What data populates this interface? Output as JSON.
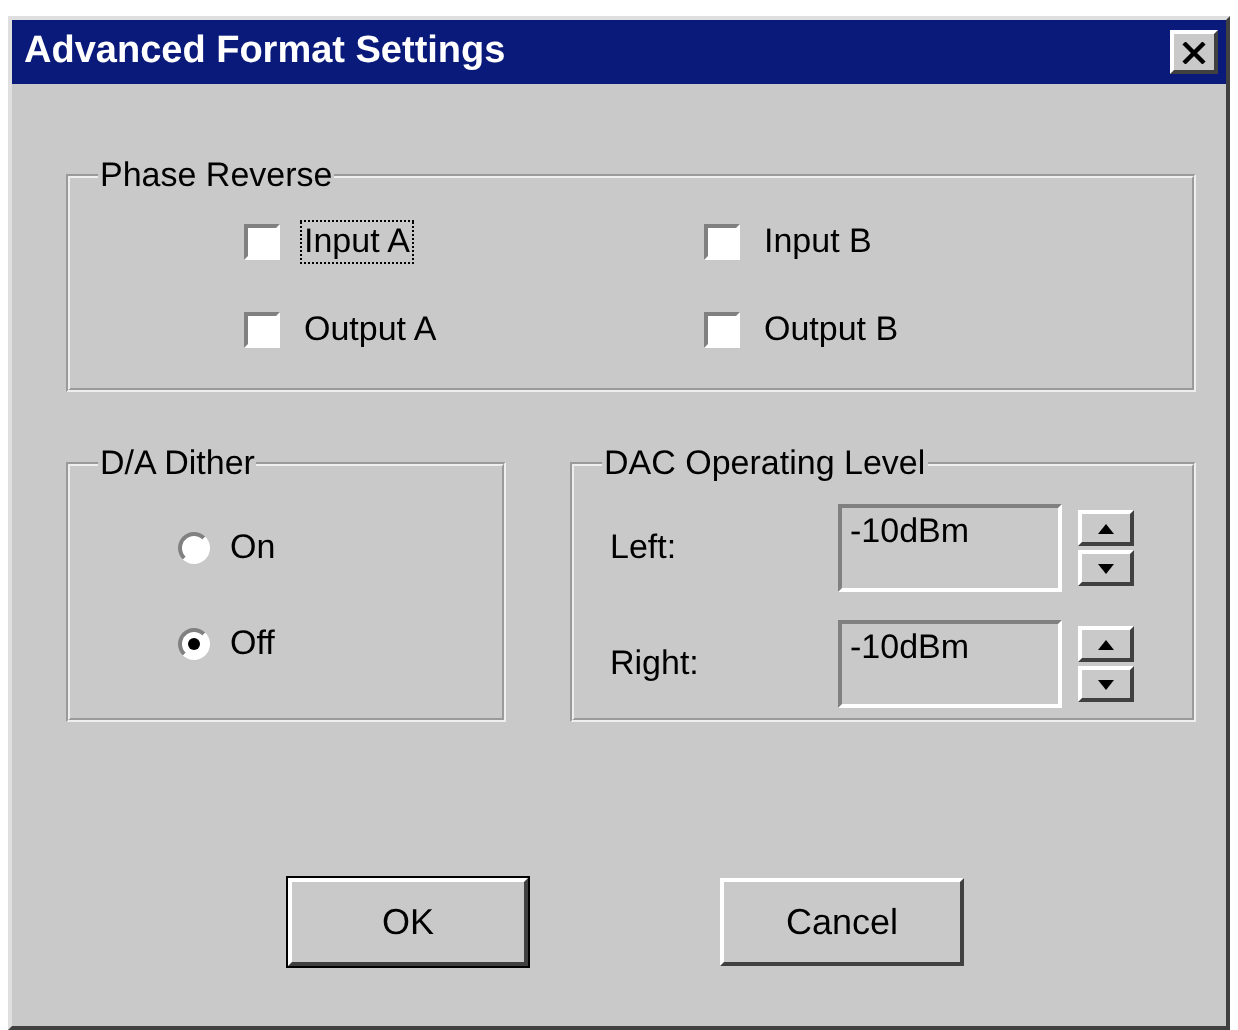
{
  "window": {
    "title": "Advanced Format Settings"
  },
  "phase_reverse": {
    "title": "Phase Reverse",
    "checkboxes": [
      {
        "label": "Input A",
        "checked": false,
        "focused": true
      },
      {
        "label": "Input B",
        "checked": false,
        "focused": false
      },
      {
        "label": "Output A",
        "checked": false,
        "focused": false
      },
      {
        "label": "Output B",
        "checked": false,
        "focused": false
      }
    ]
  },
  "dither": {
    "title": "D/A Dither",
    "options": [
      {
        "label": "On",
        "selected": false
      },
      {
        "label": "Off",
        "selected": true
      }
    ]
  },
  "dac_level": {
    "title": "DAC Operating Level",
    "fields": [
      {
        "label": "Left:",
        "value": "-10dBm"
      },
      {
        "label": "Right:",
        "value": "-10dBm"
      }
    ]
  },
  "buttons": [
    {
      "label": "OK",
      "default": true
    },
    {
      "label": "Cancel",
      "default": false
    }
  ]
}
